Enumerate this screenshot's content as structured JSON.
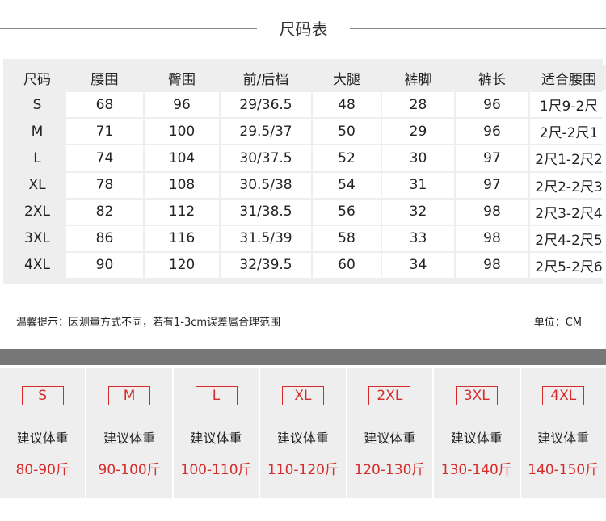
{
  "title": "尺码表",
  "table": {
    "headers": [
      "尺码",
      "腰围",
      "臀围",
      "前/后档",
      "大腿",
      "裤脚",
      "裤长",
      "适合腰围"
    ],
    "rows": [
      [
        "S",
        "68",
        "96",
        "29/36.5",
        "48",
        "28",
        "96",
        "1尺9-2尺"
      ],
      [
        "M",
        "71",
        "100",
        "29.5/37",
        "50",
        "29",
        "96",
        "2尺-2尺1"
      ],
      [
        "L",
        "74",
        "104",
        "30/37.5",
        "52",
        "30",
        "97",
        "2尺1-2尺2"
      ],
      [
        "XL",
        "78",
        "108",
        "30.5/38",
        "54",
        "31",
        "97",
        "2尺2-2尺3"
      ],
      [
        "2XL",
        "82",
        "112",
        "31/38.5",
        "56",
        "32",
        "98",
        "2尺3-2尺4"
      ],
      [
        "3XL",
        "86",
        "116",
        "31.5/39",
        "58",
        "33",
        "98",
        "2尺4-2尺5"
      ],
      [
        "4XL",
        "90",
        "120",
        "32/39.5",
        "60",
        "34",
        "98",
        "2尺5-2尺6"
      ]
    ]
  },
  "note": "温馨提示：因测量方式不同，若有1-3cm误差属合理范围",
  "unit": "单位：CM",
  "weights": [
    {
      "size": "S",
      "label": "建议体重",
      "range": "80-90斤"
    },
    {
      "size": "M",
      "label": "建议体重",
      "range": "90-100斤"
    },
    {
      "size": "L",
      "label": "建议体重",
      "range": "100-110斤"
    },
    {
      "size": "XL",
      "label": "建议体重",
      "range": "110-120斤"
    },
    {
      "size": "2XL",
      "label": "建议体重",
      "range": "120-130斤"
    },
    {
      "size": "3XL",
      "label": "建议体重",
      "range": "130-140斤"
    },
    {
      "size": "4XL",
      "label": "建议体重",
      "range": "140-150斤"
    }
  ],
  "colors": {
    "accent": "#d62b2b",
    "band": "#777777",
    "panel": "#eeeeee"
  }
}
